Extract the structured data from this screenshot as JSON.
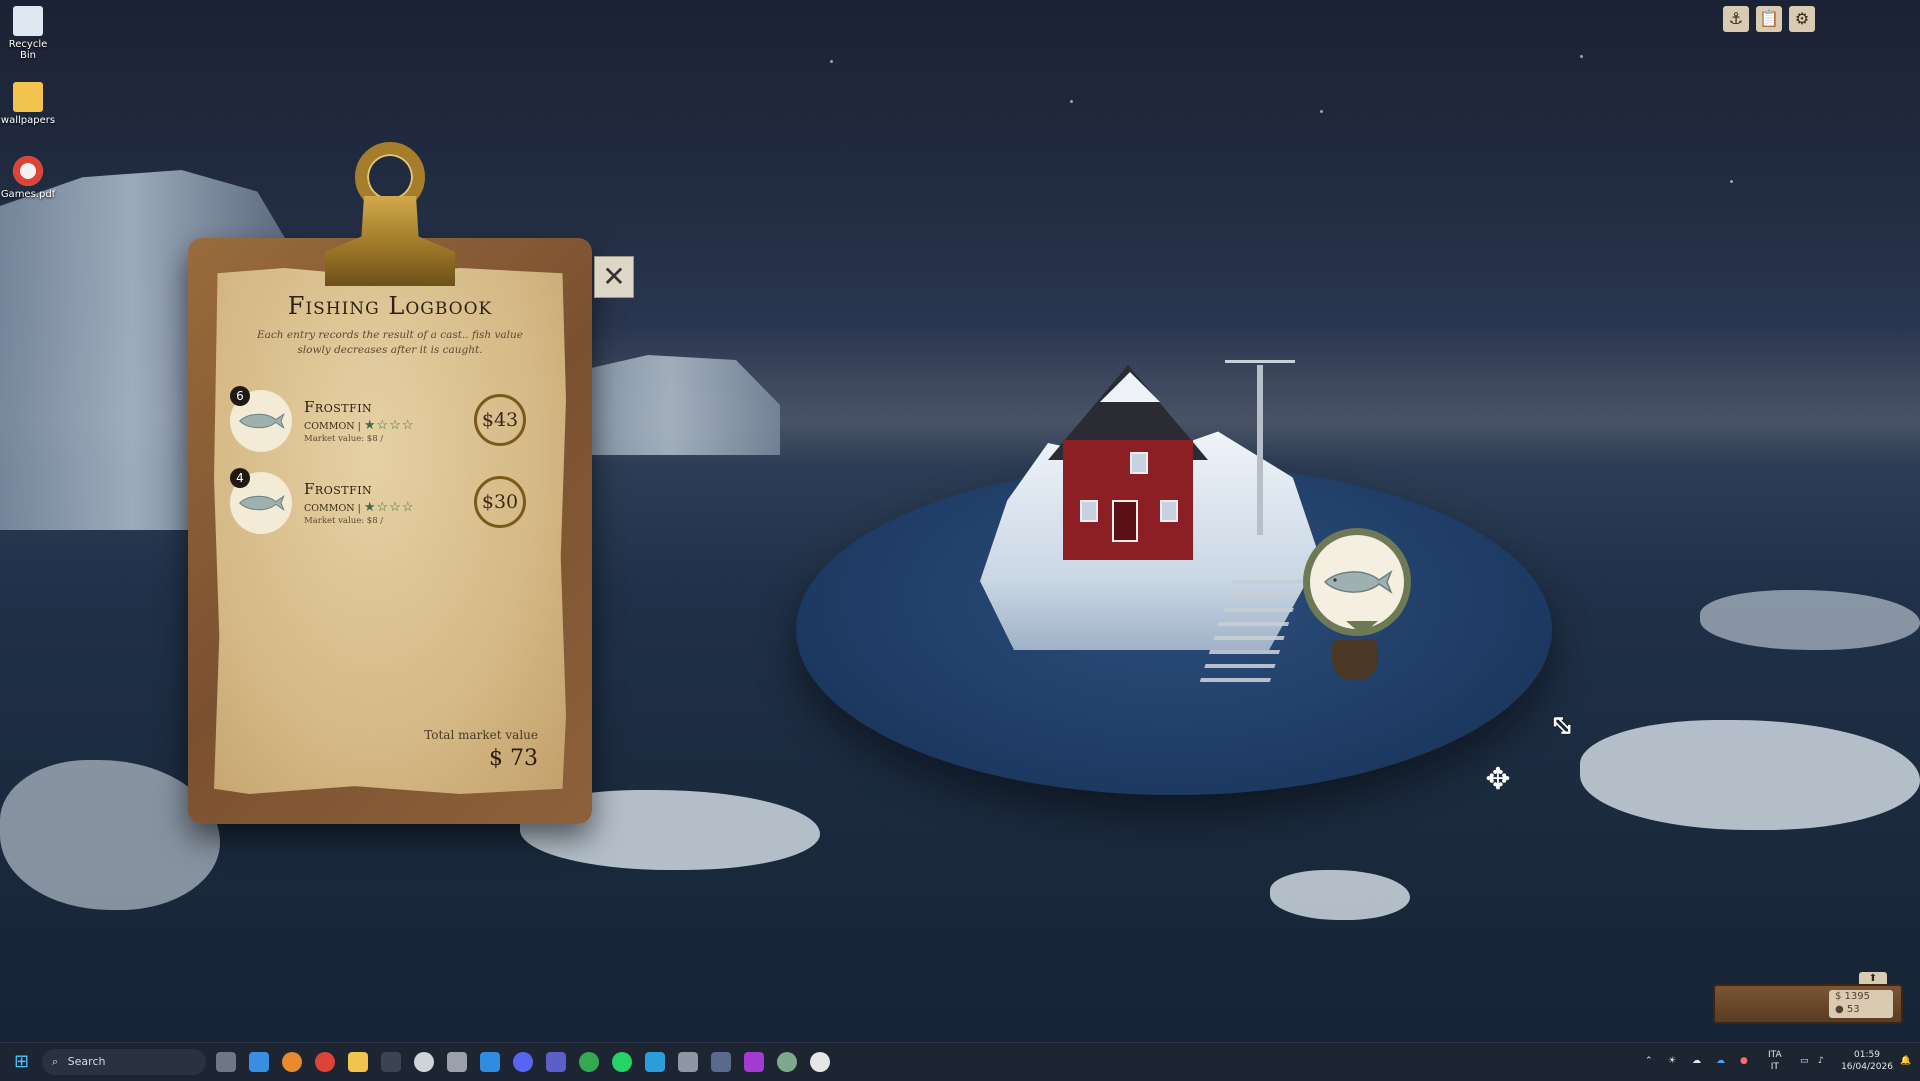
{
  "desktop": {
    "icons": [
      {
        "label": "Recycle Bin",
        "icon": "recycle-bin-icon"
      },
      {
        "label": "wallpapers",
        "icon": "folder-icon"
      },
      {
        "label": "Games.pdf",
        "icon": "chrome-pdf-icon"
      }
    ]
  },
  "logbook": {
    "title": "Fishing Logbook",
    "subtitle": "Each entry records the result of a cast.. fish value slowly decreases after it is caught.",
    "entries": [
      {
        "count": "6",
        "name": "Frostfin",
        "rarity": "COMMON |",
        "stars": "★☆☆☆",
        "market": "Market value: $8 /",
        "price": "$43"
      },
      {
        "count": "4",
        "name": "Frostfin",
        "rarity": "COMMON |",
        "stars": "★☆☆☆",
        "market": "Market value: $8 /",
        "price": "$30"
      }
    ],
    "total_label": "Total market value",
    "total_value": "$ 73",
    "close_symbol": "✕"
  },
  "hud": {
    "buttons": [
      "anchor-icon",
      "clipboard-icon",
      "gear-icon"
    ],
    "money": "$ 1395",
    "fish_count": "● 53",
    "tab_symbol": "⬆"
  },
  "taskbar": {
    "search_placeholder": "Search",
    "tray": {
      "language_top": "ITA",
      "language_bottom": "IT",
      "time": "01:59",
      "date": "16/04/2026"
    }
  },
  "colors": {
    "paper": "#d5b986",
    "board": "#7a5130",
    "ocean_disc": "#1c3961",
    "house": "#8c1f24",
    "taskbar": "#1d2533"
  }
}
